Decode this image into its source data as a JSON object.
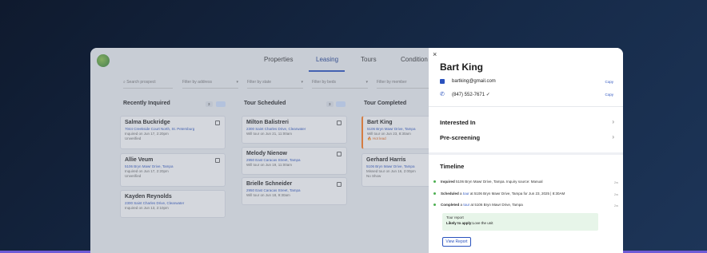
{
  "nav": {
    "tabs": [
      {
        "label": "Properties"
      },
      {
        "label": "Leasing"
      },
      {
        "label": "Tours"
      },
      {
        "label": "Condition R"
      }
    ],
    "active_index": 1
  },
  "filters": {
    "search_placeholder": "Search prospect",
    "address": "Filter by address",
    "state": "Filter by state",
    "beds": "Filter by beds",
    "member": "Filter by member"
  },
  "columns": [
    {
      "title": "Recently Inquired",
      "count": "3",
      "tag": "",
      "cards": [
        {
          "name": "Salma Buckridge",
          "address": "7044 Creekside Court North, St. Petersburg",
          "line1": "Inquired on Jun 17, 2:20pm",
          "line2": "Unverified"
        },
        {
          "name": "Allie Veum",
          "address": "5106 Bryn Mawr Drive, Tampa",
          "line1": "Inquired on Jun 17, 2:20pm",
          "line2": "Unverified"
        },
        {
          "name": "Kayden Reynolds",
          "address": "2300 Saint Charles Drive, Clearwater",
          "line1": "Inquired on Jun 13, 2:10pm",
          "line2": ""
        }
      ]
    },
    {
      "title": "Tour Scheduled",
      "count": "3",
      "tag": "",
      "cards": [
        {
          "name": "Milton Balistreri",
          "address": "2300 Saint Charles Drive, Clearwater",
          "line1": "Will tour on Jun 21, 11:00am",
          "line2": ""
        },
        {
          "name": "Melody Nienow",
          "address": "2950 East Caracas Street, Tampa",
          "line1": "Will tour on Jun 19, 11:00am",
          "line2": ""
        },
        {
          "name": "Brielle Schneider",
          "address": "2950 East Caracas Street, Tampa",
          "line1": "Will tour on Jun 18, 9:30am",
          "line2": ""
        }
      ]
    },
    {
      "title": "Tour Completed",
      "count": "",
      "tag": "",
      "cards": [
        {
          "name": "Bart King",
          "address": "5106 Bryn Mawr Drive, Tampa",
          "line1": "Will tour on Jun 23, 8:30am",
          "line2": "Hot lead"
        },
        {
          "name": "Gerhard Harris",
          "address": "5106 Bryn Mawr Drive, Tampa",
          "line1": "Missed tour on Jun 16, 2:00pm",
          "line2": "No Show"
        }
      ]
    }
  ],
  "panel": {
    "close_label": "×",
    "name": "Bart King",
    "email": "bartking@gmail.com",
    "phone": "(847) 552-7671 ✓",
    "copy_label": "Copy",
    "sections": [
      {
        "label": "Interested In"
      },
      {
        "label": "Pre-screening"
      }
    ],
    "timeline_title": "Timeline",
    "timeline": [
      {
        "verb": "Inquired",
        "text": "5106 Bryn Mawr Drive, Tampa. Inquiry source: Manual",
        "when": "2w"
      },
      {
        "verb": "Scheduled",
        "pre": "a",
        "link": "tour",
        "text": "at 5106 Bryn Mawr Drive, Tampa for Jun 23, 2025 | 8:30AM",
        "when": "2w"
      },
      {
        "verb": "Completed",
        "pre": "a",
        "link": "tour",
        "text": "at 5106 Bryn Mawr Drive, Tampa",
        "when": "2w"
      }
    ],
    "report_title": "Tour report",
    "report_label": "Likely to apply:",
    "report_value": "Love the unit",
    "view_report": "View Report"
  }
}
